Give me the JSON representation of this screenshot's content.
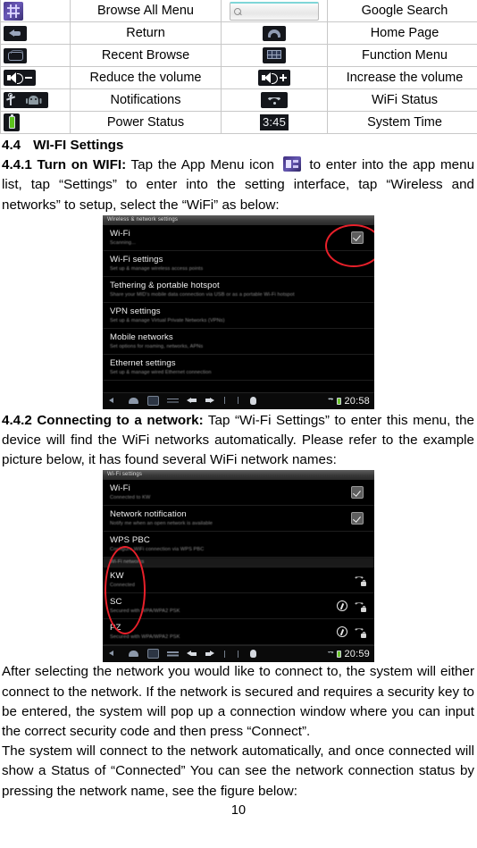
{
  "icon_table": {
    "rows": [
      {
        "icon1": "app-menu-grid-icon",
        "label1": "Browse All Menu",
        "icon2": "google-search-bar-icon",
        "label2": "Google Search"
      },
      {
        "icon1": "back-arrow-icon",
        "label1": "Return",
        "icon2": "home-house-icon",
        "label2": "Home Page"
      },
      {
        "icon1": "recent-apps-icon",
        "label1": "Recent Browse",
        "icon2": "function-menu-grid-icon",
        "label2": "Function Menu"
      },
      {
        "icon1": "volume-down-icon",
        "label1": "Reduce the volume",
        "icon2": "volume-up-icon",
        "label2": "Increase the volume"
      },
      {
        "icon1": "usb-android-notification-icon",
        "label1": "Notifications",
        "icon2": "wifi-signal-icon",
        "label2": "WiFi Status"
      },
      {
        "icon1": "battery-icon",
        "label1": "Power Status",
        "icon2": "3:45",
        "label2": "System Time"
      }
    ]
  },
  "section": {
    "number": "4.4",
    "title": "WI-FI Settings"
  },
  "s441": {
    "label": "4.4.1 Turn on WIFI:",
    "text_before_icon": " Tap the App Menu icon ",
    "text_after_icon": " to enter into the app menu list, tap “Settings” to enter into the setting interface, tap “Wireless and networks” to setup, select the “WiFi” as below:"
  },
  "s442": {
    "label": "4.4.2 Connecting to a network:",
    "text": " Tap “Wi-Fi Settings” to enter this menu, the device will find the WiFi networks automatically. Please refer to the example picture below, it has found several WiFi network names:"
  },
  "paragraphs": {
    "after_select": "After selecting the network you would like to connect to, the system will either connect to the network. If the network is secured and requires a security key to be entered, the system will pop up a connection window where you can input the correct security code and then press “Connect”.",
    "auto_connect": "The system will connect to the network automatically, and once connected will show a Status of “Connected” You can see the network connection status by pressing the network name, see the figure below:"
  },
  "screenshot1": {
    "title": "Wireless & network settings",
    "rows": [
      {
        "title": "Wi-Fi",
        "sub": "Scanning..."
      },
      {
        "title": "Wi-Fi settings",
        "sub": "Set up & manage wireless access points"
      },
      {
        "title": "Tethering & portable hotspot",
        "sub": "Share your MID's mobile data connection via USB or as a portable Wi-Fi hotspot"
      },
      {
        "title": "VPN settings",
        "sub": "Set up & manage Virtual Private Networks (VPNs)"
      },
      {
        "title": "Mobile networks",
        "sub": "Set options for roaming, networks, APNs"
      },
      {
        "title": "Ethernet settings",
        "sub": "Set up & manage wired Ethernet connection"
      }
    ],
    "status_time": "20:58"
  },
  "screenshot2": {
    "title": "Wi-Fi settings",
    "rows": [
      {
        "title": "Wi-Fi",
        "sub": "Connected to KW"
      },
      {
        "title": "Network notification",
        "sub": "Notify me when an open network is available"
      },
      {
        "title": "WPS PBC",
        "sub": "Configure WiFi connection via WPS PBC"
      }
    ],
    "section_header": "Wi-Fi networks",
    "networks": [
      {
        "name": "KW",
        "sub": "Connected",
        "secured": true,
        "wps": false
      },
      {
        "name": "SC",
        "sub": "Secured with WPA/WPA2 PSK",
        "secured": true,
        "wps": true
      },
      {
        "name": "PZ",
        "sub": "Secured with WPA/WPA2 PSK",
        "secured": true,
        "wps": true
      }
    ],
    "status_time": "20:59"
  },
  "page_number": "10",
  "colors": {
    "annotation_red": "#e8202a",
    "battery_green": "#5dc21e",
    "app_menu_purple": "#6a59b8",
    "table_border": "#c8c8c8"
  }
}
